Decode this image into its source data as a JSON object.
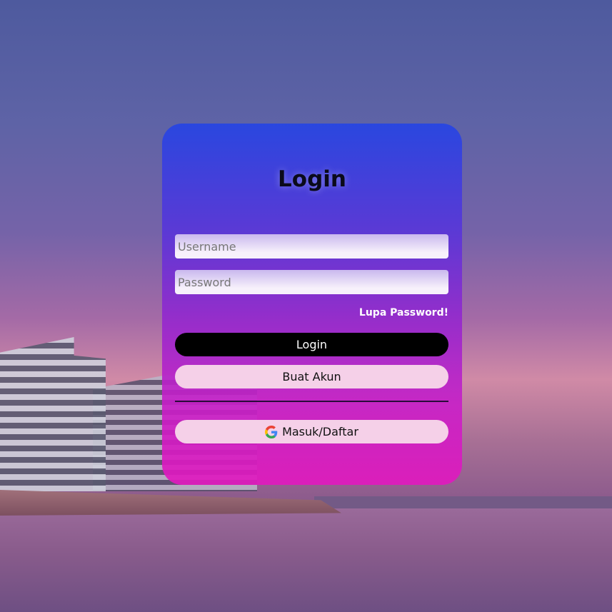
{
  "login_form": {
    "title": "Login",
    "username_placeholder": "Username",
    "password_placeholder": "Password",
    "forgot_password": "Lupa Password!",
    "login_button": "Login",
    "register_button": "Buat Akun",
    "google_button": "Masuk/Daftar",
    "google_icon": "google-g-icon"
  },
  "colors": {
    "card_top": "#2b47e0",
    "card_bottom": "#e018c0",
    "login_button": "#000000",
    "light_button": "#f5d0e8"
  }
}
